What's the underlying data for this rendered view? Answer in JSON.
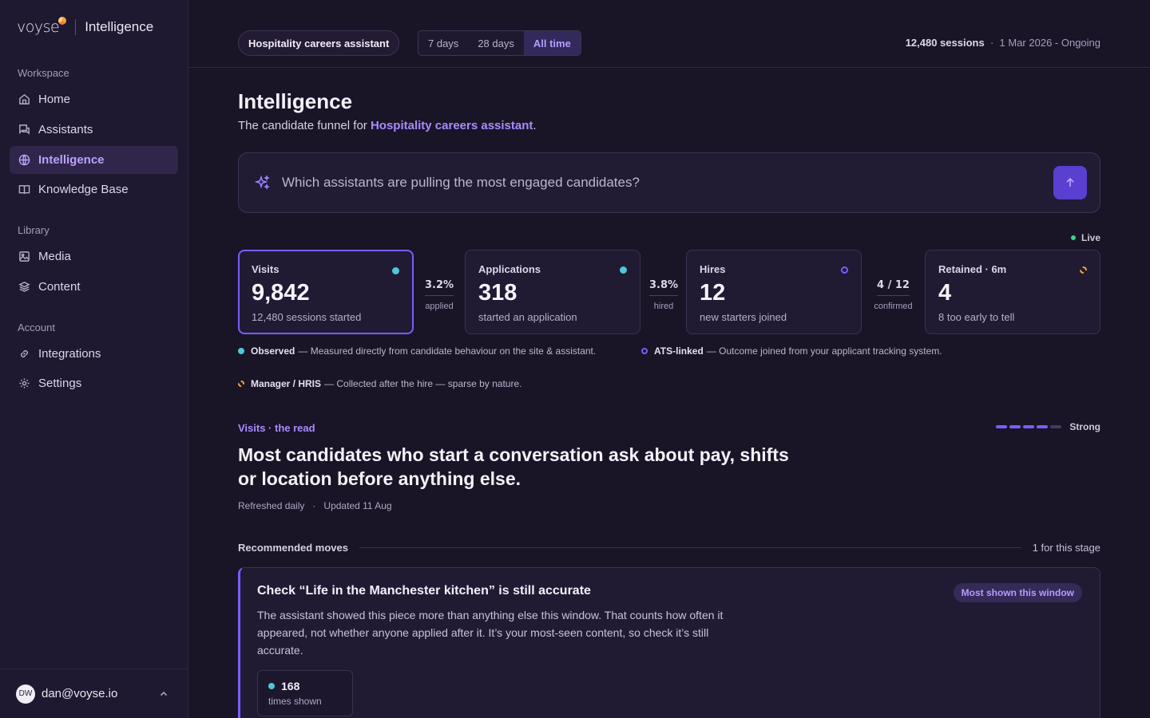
{
  "brand": {
    "logo_text": "voyse",
    "section": "Intelligence"
  },
  "sidebar": {
    "workspace_label": "Workspace",
    "workspace_items": [
      {
        "label": "Home",
        "icon": "home-icon"
      },
      {
        "label": "Assistants",
        "icon": "chat-icon"
      },
      {
        "label": "Intelligence",
        "icon": "globe-icon",
        "active": true
      },
      {
        "label": "Knowledge Base",
        "icon": "book-icon"
      }
    ],
    "library_label": "Library",
    "library_items": [
      {
        "label": "Media",
        "icon": "image-icon"
      },
      {
        "label": "Content",
        "icon": "layers-icon"
      }
    ],
    "account_label": "Account",
    "account_items": [
      {
        "label": "Integrations",
        "icon": "link-icon"
      },
      {
        "label": "Settings",
        "icon": "gear-icon"
      }
    ],
    "user": {
      "initials": "DW",
      "email": "dan@voyse.io"
    }
  },
  "topbar": {
    "assistant": "Hospitality careers assistant",
    "ranges": [
      "7 days",
      "28 days",
      "All time"
    ],
    "active_range": "All time",
    "sessions": "12,480 sessions",
    "period": "1 Mar 2026 - Ongoing"
  },
  "header": {
    "title": "Intelligence",
    "subtitle_prefix": "The candidate funnel for ",
    "subtitle_link": "Hospitality careers assistant",
    "subtitle_suffix": "."
  },
  "ask": {
    "placeholder": "Which assistants are pulling the most engaged candidates?"
  },
  "live_label": "Live",
  "funnel": [
    {
      "label": "Visits",
      "value": "9,842",
      "note": "12,480 sessions started",
      "source": "observed"
    },
    {
      "label": "Applications",
      "value": "318",
      "note": "started an application",
      "source": "observed"
    },
    {
      "label": "Hires",
      "value": "12",
      "note": "new starters joined",
      "source": "ats"
    },
    {
      "label": "Retained · 6m",
      "value": "4",
      "note": "8 too early to tell",
      "source": "manager"
    }
  ],
  "conversions": [
    {
      "value": "3.2%",
      "label": "applied"
    },
    {
      "value": "3.8%",
      "label": "hired"
    },
    {
      "value": "4 / 12",
      "label": "confirmed"
    }
  ],
  "legend": [
    {
      "name": "Observed",
      "desc": "— Measured directly from candidate behaviour on the site & assistant."
    },
    {
      "name": "ATS-linked",
      "desc": "— Outcome joined from your applicant tracking system."
    },
    {
      "name": "Manager / HRIS",
      "desc": "— Collected after the hire — sparse by nature."
    }
  ],
  "read": {
    "eyebrow": "Visits · the read",
    "strength_label": "Strong",
    "strength_level": 4,
    "strength_max": 5,
    "headline": "Most candidates who start a conversation ask about pay, shifts or location before anything else.",
    "refreshed": "Refreshed daily",
    "updated": "Updated 11 Aug"
  },
  "recommendations": {
    "title": "Recommended moves",
    "count": "1 for this stage",
    "card": {
      "title": "Check “Life in the Manchester kitchen” is still accurate",
      "badge": "Most shown this window",
      "body": "The assistant showed this piece more than anything else this window. That counts how often it appeared, not whether anyone applied after it. It’s your most-seen content, so check it’s still accurate.",
      "stat_value": "168",
      "stat_label": "times shown"
    }
  },
  "colors": {
    "accent": "#7c5cff",
    "observed": "#4fc6db",
    "manager": "#f2a93b",
    "live": "#3fd08a"
  }
}
